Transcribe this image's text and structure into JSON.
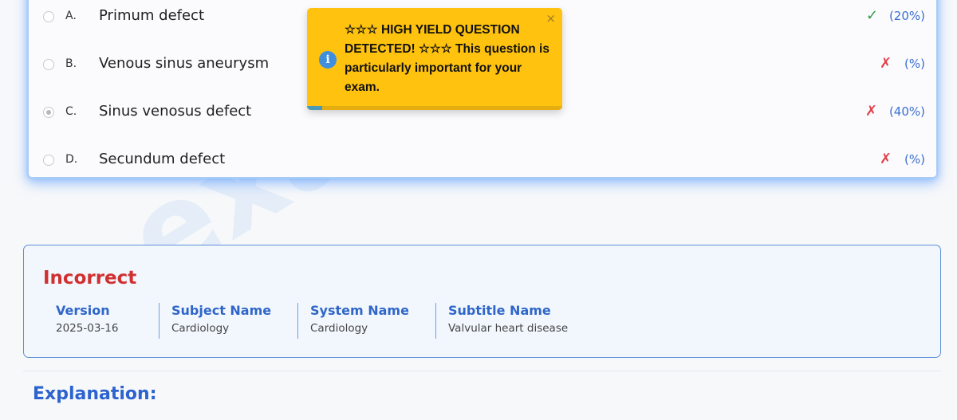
{
  "options": [
    {
      "letter": "A.",
      "text": "Primum defect",
      "mark": "✓",
      "status": "correct",
      "percent": "(20%)",
      "selected": false
    },
    {
      "letter": "B.",
      "text": "Venous sinus aneurysm",
      "mark": "✗",
      "status": "wrong",
      "percent": "(%)",
      "selected": false
    },
    {
      "letter": "C.",
      "text": "Sinus venosus defect",
      "mark": "✗",
      "status": "wrong",
      "percent": "(40%)",
      "selected": true
    },
    {
      "letter": "D.",
      "text": "Secundum defect",
      "mark": "✗",
      "status": "wrong",
      "percent": "(%)",
      "selected": false
    }
  ],
  "popup": {
    "message": "☆☆☆ HIGH YIELD QUESTION DETECTED! ☆☆☆ This question is particularly important for your exam.",
    "close": "×",
    "info_icon": "i",
    "progress": 0.06
  },
  "result": {
    "status": "Incorrect",
    "meta": [
      {
        "label": "Version",
        "value": "2025-03-16"
      },
      {
        "label": "Subject Name",
        "value": "Cardiology"
      },
      {
        "label": "System Name",
        "value": "Cardiology"
      },
      {
        "label": "Subtitle Name",
        "value": "Valvular heart disease"
      }
    ]
  },
  "explanation": {
    "title": "Explanation:"
  },
  "watermark": "exaMedLearn",
  "colors": {
    "correct": "#2e9a44",
    "wrong": "#e0404a",
    "accent": "#2f66c8",
    "popup": "#ffc20e",
    "incorrect": "#d0302f"
  }
}
